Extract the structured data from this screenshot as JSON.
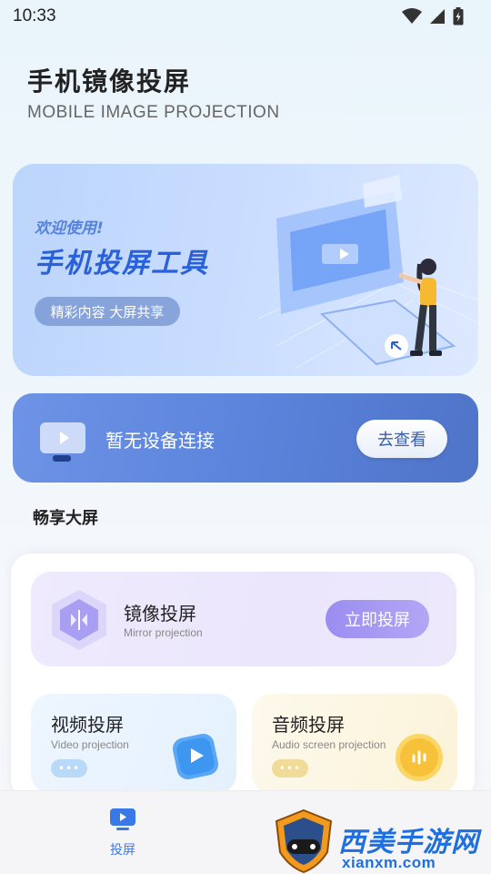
{
  "status_bar": {
    "time": "10:33"
  },
  "header": {
    "title": "手机镜像投屏",
    "subtitle": "MOBILE IMAGE PROJECTION"
  },
  "banner": {
    "welcome": "欢迎使用!",
    "headline": "手机投屏工具",
    "tag": "精彩内容 大屏共享"
  },
  "device": {
    "status": "暂无设备连接",
    "button": "去查看"
  },
  "section": {
    "title": "畅享大屏"
  },
  "mirror": {
    "name": "镜像投屏",
    "sub": "Mirror projection",
    "button": "立即投屏"
  },
  "video": {
    "name": "视频投屏",
    "sub": "Video projection",
    "dots": "•••"
  },
  "audio": {
    "name": "音频投屏",
    "sub": "Audio screen projection",
    "dots": "•••"
  },
  "bottom_nav": {
    "items": [
      {
        "label": "投屏",
        "icon": "screen-cast-icon",
        "active": true
      }
    ]
  },
  "watermark": {
    "text": "西美手游网",
    "url": "xianxm.com"
  },
  "colors": {
    "accent": "#3a78e6",
    "device_card": "#5b84dc",
    "mirror_button": "#a497f2"
  }
}
